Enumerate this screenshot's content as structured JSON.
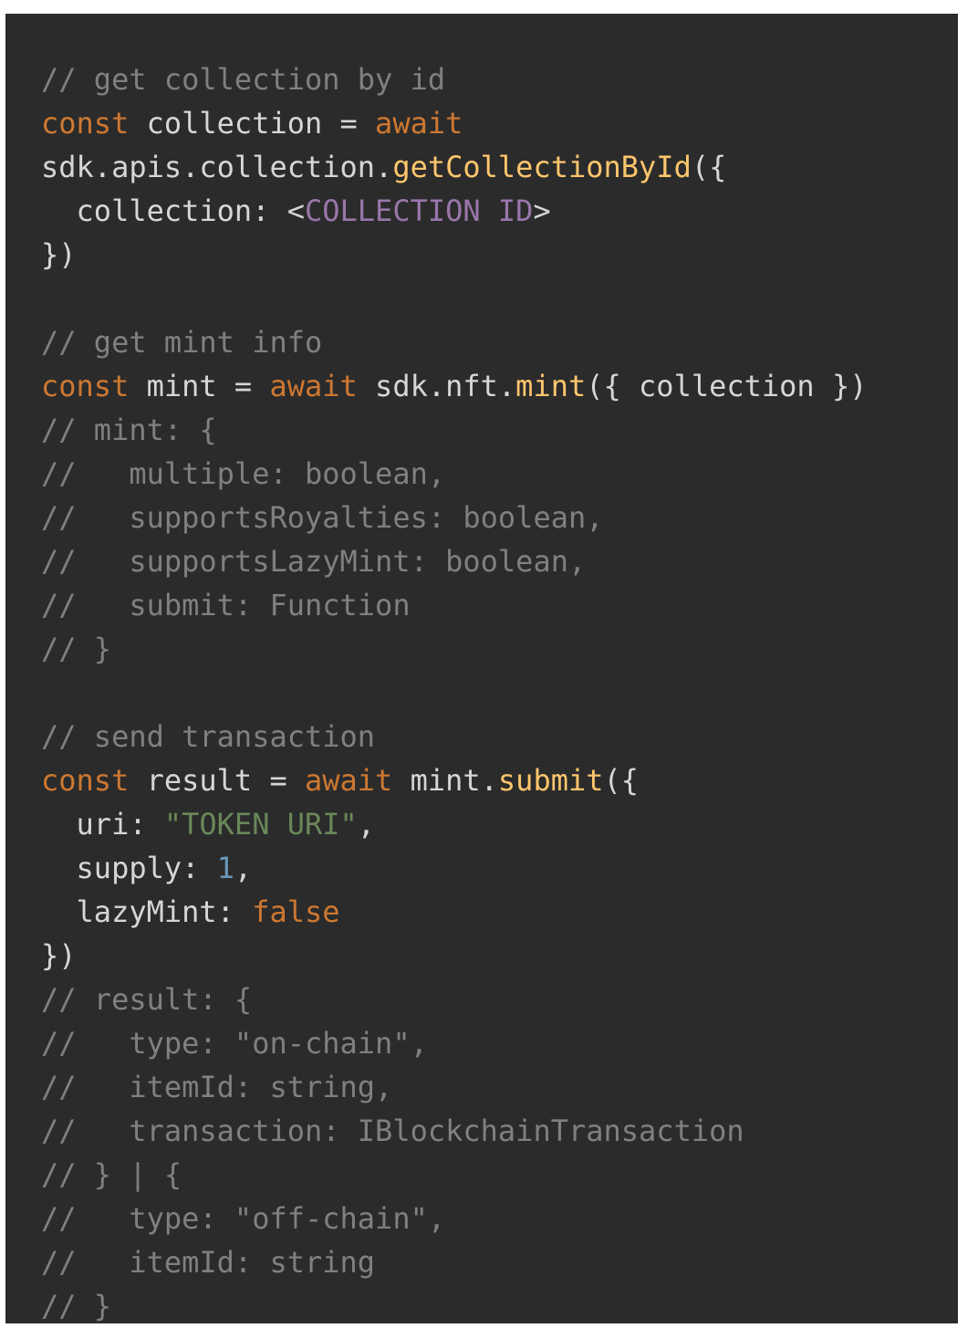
{
  "colors": {
    "background": "#2b2b2b",
    "plain": "#d4d6d8",
    "comment": "#808080",
    "keyword": "#cc7832",
    "function": "#ffc66d",
    "property": "#9876aa",
    "string": "#6a8759",
    "number": "#6897bb"
  },
  "code": {
    "lines": [
      [
        {
          "t": "comment",
          "v": "// get collection by id"
        }
      ],
      [
        {
          "t": "keyword",
          "v": "const"
        },
        {
          "t": "plain",
          "v": " collection = "
        },
        {
          "t": "keyword",
          "v": "await"
        }
      ],
      [
        {
          "t": "plain",
          "v": "sdk.apis.collection."
        },
        {
          "t": "func",
          "v": "getCollectionById"
        },
        {
          "t": "plain",
          "v": "({"
        }
      ],
      [
        {
          "t": "plain",
          "v": "  collection: <"
        },
        {
          "t": "prop",
          "v": "COLLECTION ID"
        },
        {
          "t": "plain",
          "v": ">"
        }
      ],
      [
        {
          "t": "plain",
          "v": "})"
        }
      ],
      [
        {
          "t": "plain",
          "v": ""
        }
      ],
      [
        {
          "t": "comment",
          "v": "// get mint info"
        }
      ],
      [
        {
          "t": "keyword",
          "v": "const"
        },
        {
          "t": "plain",
          "v": " mint = "
        },
        {
          "t": "keyword",
          "v": "await"
        },
        {
          "t": "plain",
          "v": " sdk.nft."
        },
        {
          "t": "func",
          "v": "mint"
        },
        {
          "t": "plain",
          "v": "({ collection })"
        }
      ],
      [
        {
          "t": "comment",
          "v": "// mint: {"
        }
      ],
      [
        {
          "t": "comment",
          "v": "//   multiple: boolean,"
        }
      ],
      [
        {
          "t": "comment",
          "v": "//   supportsRoyalties: boolean,"
        }
      ],
      [
        {
          "t": "comment",
          "v": "//   supportsLazyMint: boolean,"
        }
      ],
      [
        {
          "t": "comment",
          "v": "//   submit: Function"
        }
      ],
      [
        {
          "t": "comment",
          "v": "// }"
        }
      ],
      [
        {
          "t": "plain",
          "v": ""
        }
      ],
      [
        {
          "t": "comment",
          "v": "// send transaction"
        }
      ],
      [
        {
          "t": "keyword",
          "v": "const"
        },
        {
          "t": "plain",
          "v": " result = "
        },
        {
          "t": "keyword",
          "v": "await"
        },
        {
          "t": "plain",
          "v": " mint."
        },
        {
          "t": "func",
          "v": "submit"
        },
        {
          "t": "plain",
          "v": "({"
        }
      ],
      [
        {
          "t": "plain",
          "v": "  uri: "
        },
        {
          "t": "string",
          "v": "\"TOKEN URI\""
        },
        {
          "t": "plain",
          "v": ","
        }
      ],
      [
        {
          "t": "plain",
          "v": "  supply: "
        },
        {
          "t": "number",
          "v": "1"
        },
        {
          "t": "plain",
          "v": ","
        }
      ],
      [
        {
          "t": "plain",
          "v": "  lazyMint: "
        },
        {
          "t": "keyword",
          "v": "false"
        }
      ],
      [
        {
          "t": "plain",
          "v": "})"
        }
      ],
      [
        {
          "t": "comment",
          "v": "// result: {"
        }
      ],
      [
        {
          "t": "comment",
          "v": "//   type: \"on-chain\","
        }
      ],
      [
        {
          "t": "comment",
          "v": "//   itemId: string,"
        }
      ],
      [
        {
          "t": "comment",
          "v": "//   transaction: IBlockchainTransaction"
        }
      ],
      [
        {
          "t": "comment",
          "v": "// } | {"
        }
      ],
      [
        {
          "t": "comment",
          "v": "//   type: \"off-chain\","
        }
      ],
      [
        {
          "t": "comment",
          "v": "//   itemId: string"
        }
      ],
      [
        {
          "t": "comment",
          "v": "// }"
        }
      ]
    ]
  }
}
